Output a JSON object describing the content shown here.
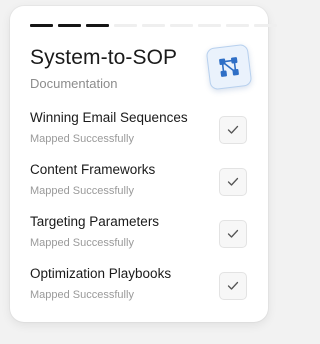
{
  "progress": {
    "total": 9,
    "completed": 3
  },
  "header": {
    "title": "System-to-SOP",
    "subtitle": "Documentation",
    "icon": "workflow-icon"
  },
  "items": [
    {
      "title": "Winning Email Sequences",
      "status": "Mapped Successfully",
      "checked": true
    },
    {
      "title": "Content Frameworks",
      "status": "Mapped Successfully",
      "checked": true
    },
    {
      "title": "Targeting Parameters",
      "status": "Mapped Successfully",
      "checked": true
    },
    {
      "title": "Optimization Playbooks",
      "status": "Mapped Successfully",
      "checked": true
    }
  ],
  "colors": {
    "accent": "#2f6fc6",
    "text": "#1a1a1a",
    "muted": "#8c8c8c"
  }
}
